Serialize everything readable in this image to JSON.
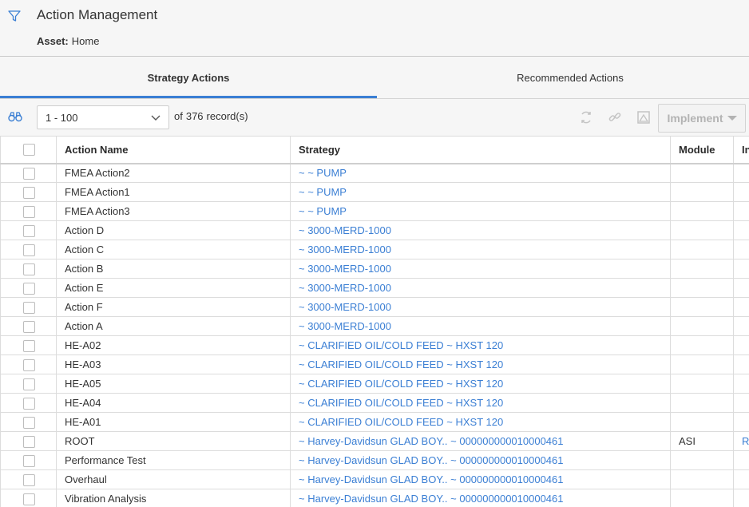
{
  "header": {
    "icon": "filter-icon",
    "title": "Action Management",
    "asset_label": "Asset:",
    "asset_value": "Home"
  },
  "tabs": [
    {
      "label": "Strategy Actions",
      "active": true
    },
    {
      "label": "Recommended Actions",
      "active": false
    }
  ],
  "toolbar": {
    "range_value": "1 - 100",
    "records_of": "of",
    "records_count": "376",
    "records_suffix": "record(s)",
    "implement_label": "Implement"
  },
  "table": {
    "columns": [
      "Action Name",
      "Strategy",
      "Module",
      "In"
    ],
    "rows": [
      {
        "name": "FMEA Action2",
        "strategy": "~ ~ PUMP",
        "module": "",
        "extra": ""
      },
      {
        "name": "FMEA Action1",
        "strategy": "~ ~ PUMP",
        "module": "",
        "extra": ""
      },
      {
        "name": "FMEA Action3",
        "strategy": "~ ~ PUMP",
        "module": "",
        "extra": ""
      },
      {
        "name": "Action D",
        "strategy": "~ 3000-MERD-1000",
        "module": "",
        "extra": ""
      },
      {
        "name": "Action C",
        "strategy": "~ 3000-MERD-1000",
        "module": "",
        "extra": ""
      },
      {
        "name": "Action B",
        "strategy": "~ 3000-MERD-1000",
        "module": "",
        "extra": ""
      },
      {
        "name": "Action E",
        "strategy": "~ 3000-MERD-1000",
        "module": "",
        "extra": ""
      },
      {
        "name": "Action F",
        "strategy": "~ 3000-MERD-1000",
        "module": "",
        "extra": ""
      },
      {
        "name": "Action A",
        "strategy": "~ 3000-MERD-1000",
        "module": "",
        "extra": ""
      },
      {
        "name": "HE-A02",
        "strategy": "~ CLARIFIED OIL/COLD FEED ~ HXST 120",
        "module": "",
        "extra": ""
      },
      {
        "name": "HE-A03",
        "strategy": "~ CLARIFIED OIL/COLD FEED ~ HXST 120",
        "module": "",
        "extra": ""
      },
      {
        "name": "HE-A05",
        "strategy": "~ CLARIFIED OIL/COLD FEED ~ HXST 120",
        "module": "",
        "extra": ""
      },
      {
        "name": "HE-A04",
        "strategy": "~ CLARIFIED OIL/COLD FEED ~ HXST 120",
        "module": "",
        "extra": ""
      },
      {
        "name": "HE-A01",
        "strategy": "~ CLARIFIED OIL/COLD FEED ~ HXST 120",
        "module": "",
        "extra": ""
      },
      {
        "name": "ROOT",
        "strategy": "~ Harvey-Davidsun GLAD BOY.. ~ 000000000010000461",
        "module": "ASI",
        "extra": "RC"
      },
      {
        "name": "Performance Test",
        "strategy": "~ Harvey-Davidsun GLAD BOY.. ~ 000000000010000461",
        "module": "",
        "extra": ""
      },
      {
        "name": "Overhaul",
        "strategy": "~ Harvey-Davidsun GLAD BOY.. ~ 000000000010000461",
        "module": "",
        "extra": ""
      },
      {
        "name": "Vibration Analysis",
        "strategy": "~ Harvey-Davidsun GLAD BOY.. ~ 000000000010000461",
        "module": "",
        "extra": ""
      }
    ]
  },
  "colors": {
    "accent": "#3b7fd4",
    "background": "#f6f6f6",
    "link": "#3b7fd4"
  }
}
